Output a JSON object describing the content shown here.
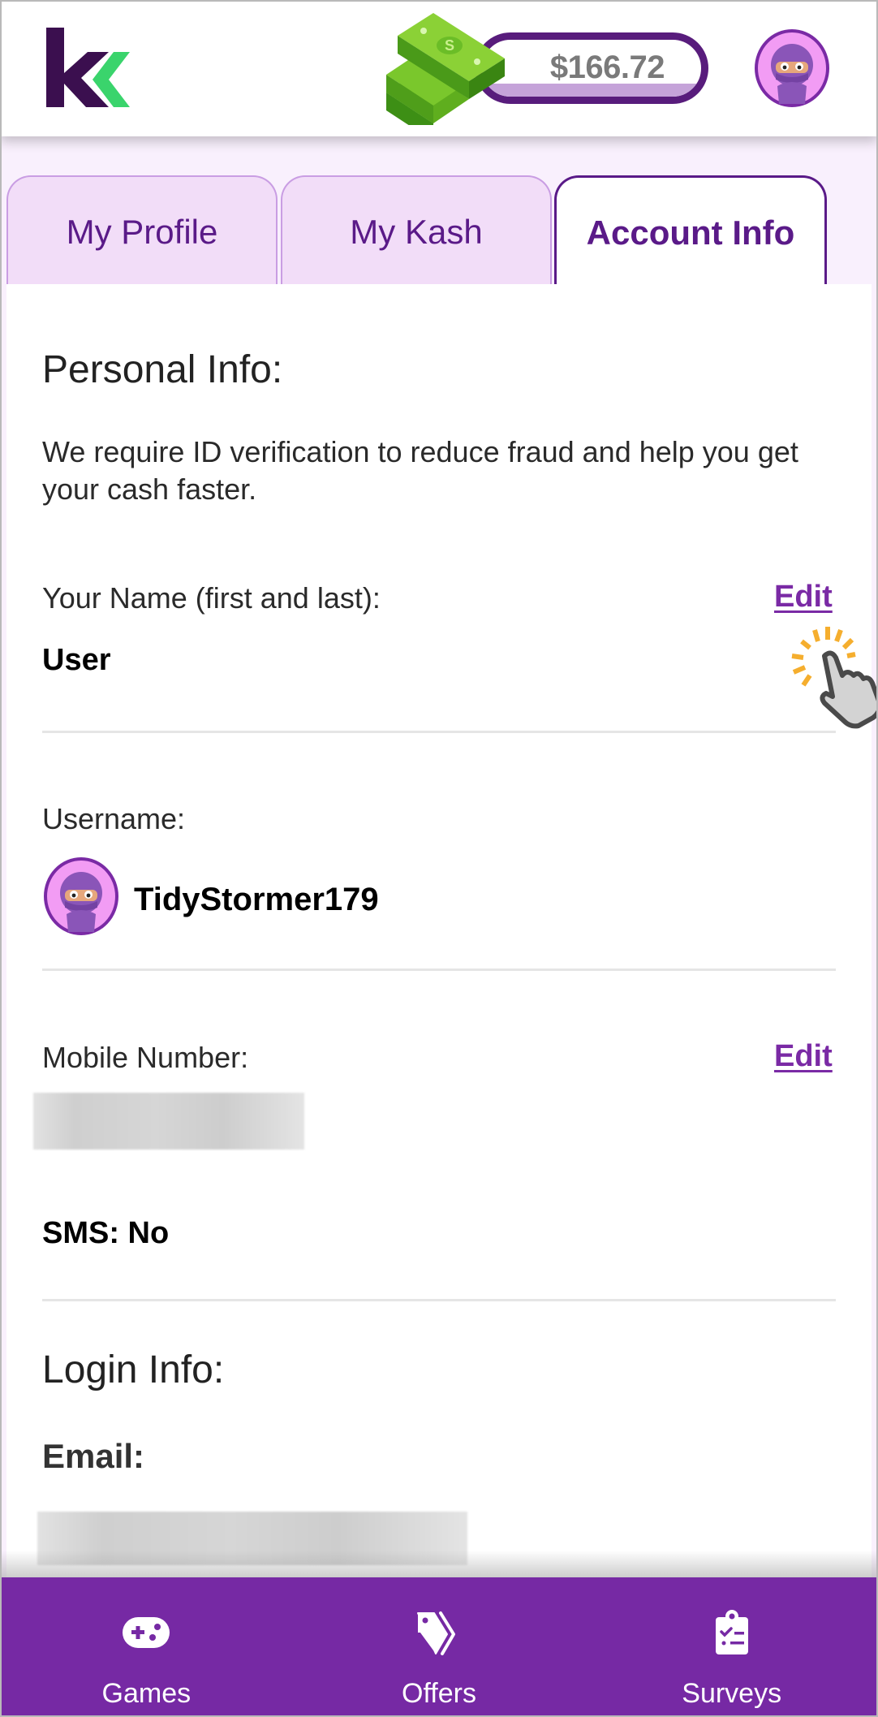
{
  "header": {
    "logo": "kashkick-logo",
    "balance": "$166.72",
    "money_icon": "cash-stack-icon",
    "avatar": "ninja-avatar"
  },
  "tabs": [
    {
      "label": "My Profile",
      "active": false
    },
    {
      "label": "My Kash",
      "active": false
    },
    {
      "label": "Account Info",
      "active": true
    }
  ],
  "personal": {
    "title": "Personal Info:",
    "description": "We require ID verification to reduce fraud and help you get your cash faster.",
    "name": {
      "label": "Your Name (first and last):",
      "value": "User",
      "edit_label": "Edit"
    },
    "username": {
      "label": "Username:",
      "value": "TidyStormer179"
    },
    "mobile": {
      "label": "Mobile Number:",
      "value": "[redacted]",
      "edit_label": "Edit",
      "sms": "SMS: No"
    }
  },
  "login": {
    "title": "Login Info:",
    "email_label": "Email:",
    "email_value": "[redacted]"
  },
  "nav": [
    {
      "label": "Games",
      "icon": "gamepad-icon"
    },
    {
      "label": "Offers",
      "icon": "tags-icon"
    },
    {
      "label": "Surveys",
      "icon": "clipboard-check-icon"
    }
  ],
  "colors": {
    "brand_purple": "#7629a4",
    "dark_purple": "#581c7c",
    "logo_green": "#3ad46c",
    "tab_bg": "#f2ddf8",
    "edit_link": "#7a2aa5"
  }
}
